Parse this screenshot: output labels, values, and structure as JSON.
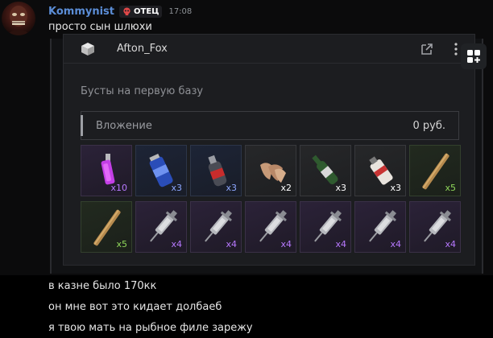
{
  "message": {
    "username": "Kommynist",
    "role": "ОТЕЦ",
    "timestamp": "17:08",
    "text": "просто сын шлюхи"
  },
  "embed": {
    "seller": "Afton_Fox",
    "section_title": "Бусты на первую базу",
    "investment_label": "Вложение",
    "investment_value": "0 руб."
  },
  "items": [
    {
      "name": "pink-stimulant",
      "rarity": "purple",
      "qty": "x10"
    },
    {
      "name": "blue-can",
      "rarity": "blue",
      "qty": "x3"
    },
    {
      "name": "injector-bottle",
      "rarity": "blue",
      "qty": "x3"
    },
    {
      "name": "bread-chips",
      "rarity": "gray",
      "qty": "x2"
    },
    {
      "name": "green-bottle",
      "rarity": "gray",
      "qty": "x3"
    },
    {
      "name": "red-tube",
      "rarity": "gray",
      "qty": "x3"
    },
    {
      "name": "wooden-stick",
      "rarity": "green",
      "qty": "x5"
    },
    {
      "name": "wooden-stick",
      "rarity": "green",
      "qty": "x5"
    },
    {
      "name": "syringe",
      "rarity": "purple",
      "qty": "x4"
    },
    {
      "name": "syringe",
      "rarity": "purple",
      "qty": "x4"
    },
    {
      "name": "syringe",
      "rarity": "purple",
      "qty": "x4"
    },
    {
      "name": "syringe",
      "rarity": "purple",
      "qty": "x4"
    },
    {
      "name": "syringe",
      "rarity": "purple",
      "qty": "x4"
    },
    {
      "name": "syringe",
      "rarity": "purple",
      "qty": "x4"
    }
  ],
  "followups": [
    "в казне было 170кк",
    "он мне вот это кидает долбаеб",
    "я твою мать на рыбное филе зарежу"
  ],
  "colors": {
    "username": "#5b8dd6",
    "rarity_purple": "#b879ff",
    "rarity_blue": "#8da7ff",
    "rarity_green": "#8fd65a"
  }
}
